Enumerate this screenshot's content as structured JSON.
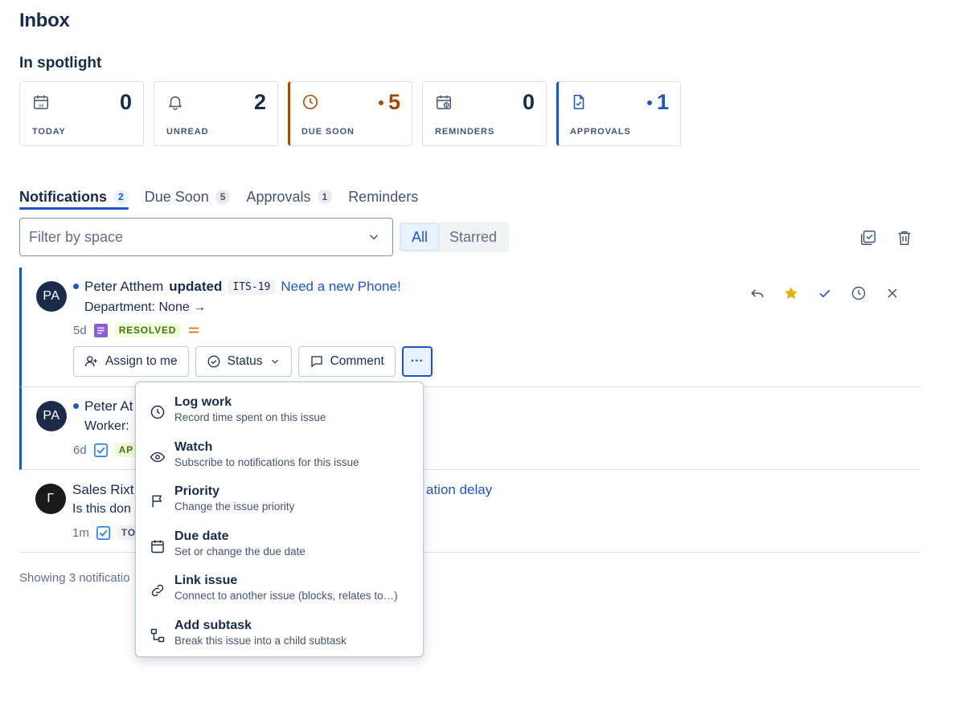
{
  "page": {
    "title": "Inbox",
    "spotlight_title": "In spotlight"
  },
  "cards": [
    {
      "label": "TODAY",
      "count": "0",
      "icon": "calendar-icon"
    },
    {
      "label": "UNREAD",
      "count": "2",
      "icon": "bell-icon"
    },
    {
      "label": "DUE SOON",
      "count": "5",
      "icon": "clock-icon",
      "accent": "#a54800"
    },
    {
      "label": "REMINDERS",
      "count": "0",
      "icon": "calendar-clock-icon"
    },
    {
      "label": "APPROVALS",
      "count": "1",
      "icon": "document-check-icon",
      "accent": "#1d56c8"
    }
  ],
  "tabs": [
    {
      "label": "Notifications",
      "badge": "2",
      "active": true
    },
    {
      "label": "Due Soon",
      "badge": "5"
    },
    {
      "label": "Approvals",
      "badge": "1"
    },
    {
      "label": "Reminders"
    }
  ],
  "filter": {
    "placeholder": "Filter by space"
  },
  "segmented": {
    "all": "All",
    "starred": "Starred",
    "selected": "All"
  },
  "notifications": [
    {
      "avatar": "PA",
      "actor": "Peter Atthem",
      "verb": "updated",
      "key": "ITS-19",
      "title": "Need a new Phone!",
      "detail": "Department: None →",
      "age": "5d",
      "status": "RESOLVED",
      "actions": {
        "assign": "Assign to me",
        "status": "Status",
        "comment": "Comment",
        "more": "···"
      }
    },
    {
      "avatar": "PA",
      "actor": "Peter At",
      "detail": "Worker:",
      "age": "6d",
      "status": "AP"
    },
    {
      "avatar": "Γ",
      "actor": "Sales Rixt",
      "title_tail": "ation delay",
      "detail": "Is this don",
      "age": "1m",
      "status": "TO"
    }
  ],
  "footer": {
    "text": "Showing 3 notificatio"
  },
  "menu": [
    {
      "title": "Log work",
      "desc": "Record time spent on this issue",
      "icon": "clock-icon"
    },
    {
      "title": "Watch",
      "desc": "Subscribe to notifications for this issue",
      "icon": "eye-icon"
    },
    {
      "title": "Priority",
      "desc": "Change the issue priority",
      "icon": "flag-icon"
    },
    {
      "title": "Due date",
      "desc": "Set or change the due date",
      "icon": "calendar-icon"
    },
    {
      "title": "Link issue",
      "desc": "Connect to another issue (blocks, relates to…)",
      "icon": "link-icon"
    },
    {
      "title": "Add subtask",
      "desc": "Break this issue into a child subtask",
      "icon": "subtask-icon"
    }
  ],
  "colors": {
    "accent_blue": "#1d56c8",
    "accent_orange": "#a54800",
    "star": "#e2b203",
    "text": "#172b4d"
  }
}
